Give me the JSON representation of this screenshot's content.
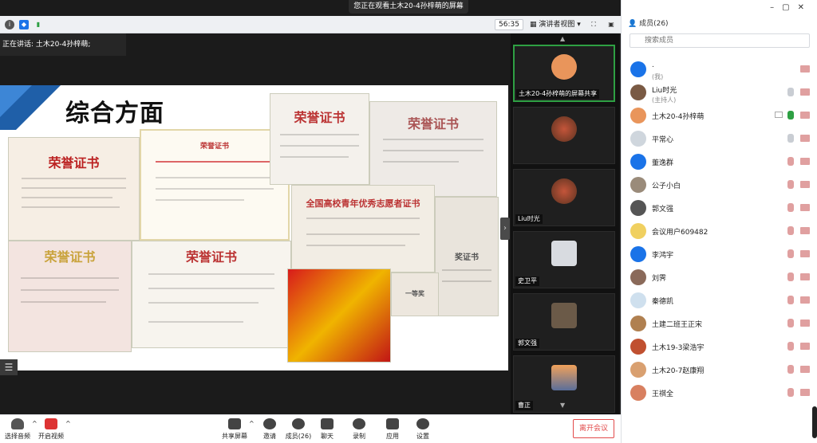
{
  "banner": "您正在观看土木20-4孙梓萌的屏幕",
  "toolbar": {
    "time": "56:35",
    "view": "演讲者视图"
  },
  "speaking": "正在讲话: 土木20-4孙梓萌;",
  "slide": {
    "title": "综合方面",
    "certs": [
      {
        "title": "荣誉证书"
      },
      {
        "title": "荣誉证书"
      },
      {
        "title": "荣誉证书"
      },
      {
        "title": "荣誉证书"
      },
      {
        "title": "荣誉证书"
      },
      {
        "title": "荣誉证书"
      },
      {
        "title": "全国高校青年优秀志愿者证书"
      },
      {
        "title": "奖证书"
      },
      {
        "title": "一等奖"
      }
    ]
  },
  "strip": {
    "tiles": [
      {
        "label": "土木20-4孙梓萌的屏幕共享"
      },
      {
        "label": ""
      },
      {
        "label": "Liu时光"
      },
      {
        "label": "史卫平"
      },
      {
        "label": "郭文强"
      },
      {
        "label": "曹正"
      }
    ]
  },
  "panel": {
    "title": "成员(26)",
    "search_placeholder": "搜索成员",
    "members": [
      {
        "name": ".",
        "sub": "(我)"
      },
      {
        "name": "Liu时光",
        "sub": "(主持人)"
      },
      {
        "name": "土木20-4孙梓萌",
        "sub": ""
      },
      {
        "name": "平常心",
        "sub": ""
      },
      {
        "name": "董逸群",
        "sub": ""
      },
      {
        "name": "公子小白",
        "sub": ""
      },
      {
        "name": "郭文强",
        "sub": ""
      },
      {
        "name": "会议用户609482",
        "sub": ""
      },
      {
        "name": "李鸿宇",
        "sub": ""
      },
      {
        "name": "刘霁",
        "sub": ""
      },
      {
        "name": "秦德凯",
        "sub": ""
      },
      {
        "name": "土建二班王正宋",
        "sub": ""
      },
      {
        "name": "土木19-3梁浩宇",
        "sub": ""
      },
      {
        "name": "土木20-7赵康翔",
        "sub": ""
      },
      {
        "name": "王祺全",
        "sub": ""
      }
    ]
  },
  "bottom": {
    "audio": "选择音频",
    "video": "开启视频",
    "share": "共享屏幕",
    "invite": "邀请",
    "members": "成员(26)",
    "chat": "聊天",
    "record": "录制",
    "apps": "应用",
    "settings": "设置",
    "leave": "离开会议"
  },
  "colors": {
    "accent": "#2ea043",
    "leave": "#e24a4a",
    "brand": "#1a73e8"
  }
}
